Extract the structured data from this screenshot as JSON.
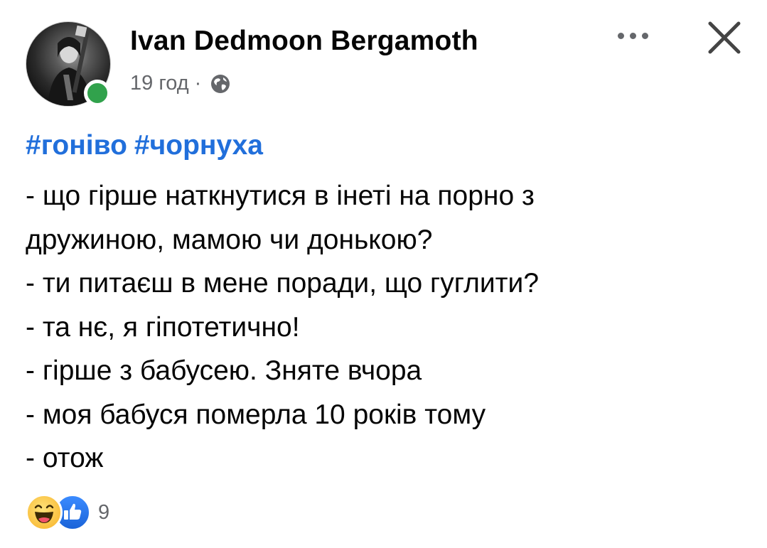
{
  "post": {
    "author": "Ivan Dedmoon Bergamoth",
    "time": "19 год",
    "separator": "·",
    "privacy_icon": "globe-icon",
    "hashtags": [
      "#гоніво",
      "#чорнуха"
    ],
    "lines": [
      "- що гірше наткнутися в інеті на порно з",
      "дружиною, мамою чи донькою?",
      "- ти питаєш в мене поради, що гуглити?",
      "- та нє, я гіпотетично!",
      "- гірше з бабусею. Зняте вчора",
      "- моя бабуся померла 10 років тому",
      "- отож"
    ],
    "reactions": {
      "icons": [
        "haha-icon",
        "like-icon"
      ],
      "count": "9"
    }
  },
  "colors": {
    "hashtag": "#216fdb",
    "meta": "#65676b",
    "online": "#31a24c",
    "like": "#1a63d8"
  }
}
